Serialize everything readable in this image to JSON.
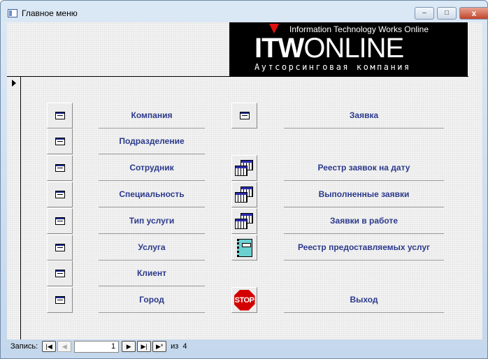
{
  "window": {
    "title": "Главное меню",
    "minimize": "–",
    "maximize": "□",
    "close": "x"
  },
  "logo": {
    "tagline": "Information Technology Works Online",
    "brand_bold": "ITW",
    "brand_light": "ONLINE",
    "subtitle": "Аутсорсинговая компания"
  },
  "left_menu": [
    {
      "label": "Компания",
      "icon": "form-icon"
    },
    {
      "label": "Подразделение",
      "icon": "form-icon"
    },
    {
      "label": "Сотрудник",
      "icon": "form-icon"
    },
    {
      "label": "Специальность",
      "icon": "form-icon"
    },
    {
      "label": "Тип услуги",
      "icon": "form-icon"
    },
    {
      "label": "Услуга",
      "icon": "form-icon"
    },
    {
      "label": "Клиент",
      "icon": "form-icon"
    },
    {
      "label": "Город",
      "icon": "form-icon"
    }
  ],
  "right_menu": [
    {
      "label": "Заявка",
      "icon": "form-icon"
    },
    {
      "label": "Реестр заявок на дату",
      "icon": "table-icon"
    },
    {
      "label": "Выполненные заявки",
      "icon": "table-icon"
    },
    {
      "label": "Заявки в работе",
      "icon": "table-icon"
    },
    {
      "label": "Реестр предоставляемых услуг",
      "icon": "report-icon"
    },
    {
      "label": "Выход",
      "icon": "stop-icon",
      "icon_text": "STOP"
    }
  ],
  "navigator": {
    "label": "Запись:",
    "current": "1",
    "of_label": "из",
    "total": "4"
  }
}
